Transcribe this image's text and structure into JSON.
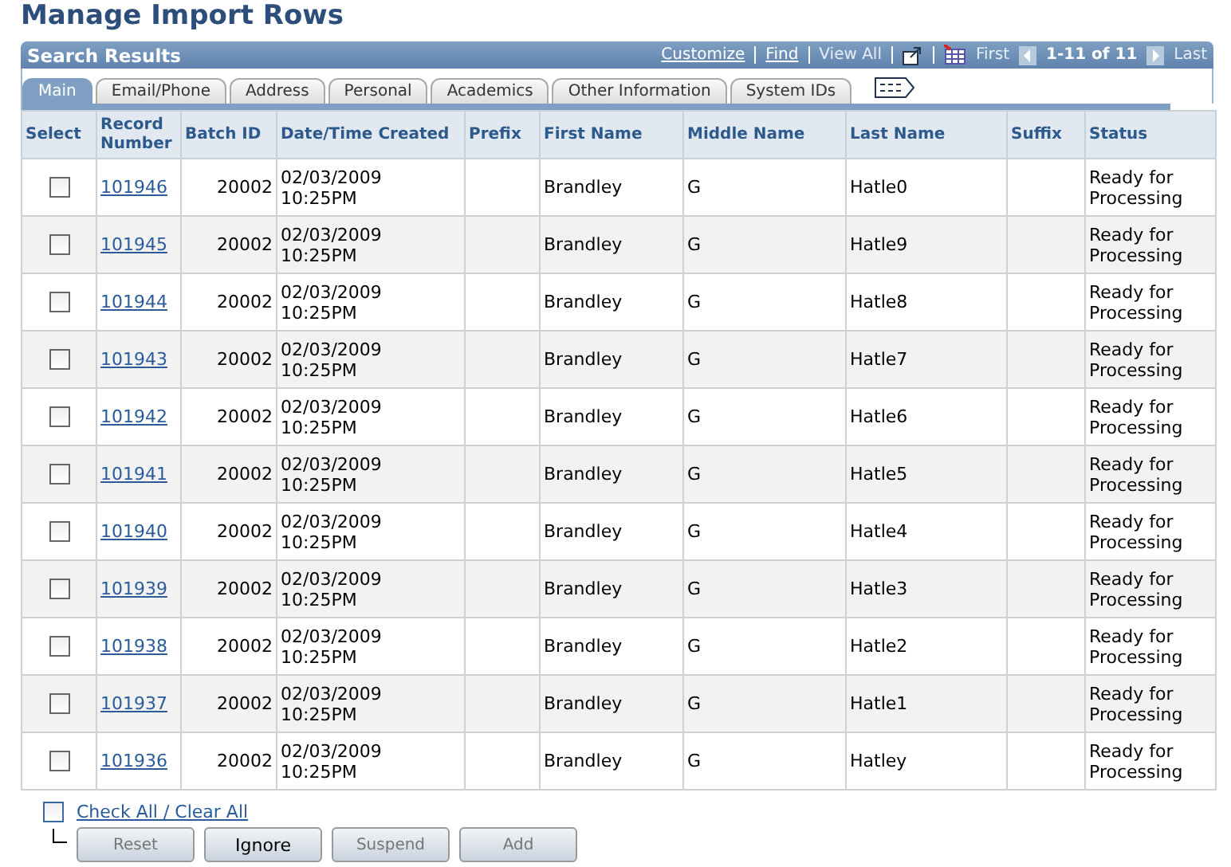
{
  "page_title": "Manage Import Rows",
  "grid": {
    "title": "Search Results",
    "links": [
      {
        "label": "Customize",
        "disabled": false
      },
      {
        "label": "Find",
        "disabled": false
      },
      {
        "label": "View All",
        "disabled": true
      }
    ],
    "first": {
      "label": "First",
      "disabled": true
    },
    "range": "1-11 of 11",
    "last": {
      "label": "Last",
      "disabled": true
    },
    "tabs": [
      {
        "label": "Main",
        "selected": true
      },
      {
        "label": "Email/Phone",
        "selected": false
      },
      {
        "label": "Address",
        "selected": false
      },
      {
        "label": "Personal",
        "selected": false
      },
      {
        "label": "Academics",
        "selected": false
      },
      {
        "label": "Other Information",
        "selected": false
      },
      {
        "label": "System IDs",
        "selected": false
      }
    ],
    "columns": [
      "Select",
      "Record Number",
      "Batch ID",
      "Date/Time Created",
      "Prefix",
      "First Name",
      "Middle Name",
      "Last Name",
      "Suffix",
      "Status"
    ],
    "rows": [
      {
        "checked": false,
        "record_number": "101946",
        "batch_id": "20002",
        "created": "02/03/2009 10:25PM",
        "first_name": "Brandley",
        "middle_name": "G",
        "last_name": "Hatle0",
        "status": "Ready for Processing"
      },
      {
        "checked": false,
        "record_number": "101945",
        "batch_id": "20002",
        "created": "02/03/2009 10:25PM",
        "first_name": "Brandley",
        "middle_name": "G",
        "last_name": "Hatle9",
        "status": "Ready for Processing"
      },
      {
        "checked": false,
        "record_number": "101944",
        "batch_id": "20002",
        "created": "02/03/2009 10:25PM",
        "first_name": "Brandley",
        "middle_name": "G",
        "last_name": "Hatle8",
        "status": "Ready for Processing"
      },
      {
        "checked": false,
        "record_number": "101943",
        "batch_id": "20002",
        "created": "02/03/2009 10:25PM",
        "first_name": "Brandley",
        "middle_name": "G",
        "last_name": "Hatle7",
        "status": "Ready for Processing"
      },
      {
        "checked": false,
        "record_number": "101942",
        "batch_id": "20002",
        "created": "02/03/2009 10:25PM",
        "first_name": "Brandley",
        "middle_name": "G",
        "last_name": "Hatle6",
        "status": "Ready for Processing"
      },
      {
        "checked": false,
        "record_number": "101941",
        "batch_id": "20002",
        "created": "02/03/2009 10:25PM",
        "first_name": "Brandley",
        "middle_name": "G",
        "last_name": "Hatle5",
        "status": "Ready for Processing"
      },
      {
        "checked": false,
        "record_number": "101940",
        "batch_id": "20002",
        "created": "02/03/2009 10:25PM",
        "first_name": "Brandley",
        "middle_name": "G",
        "last_name": "Hatle4",
        "status": "Ready for Processing"
      },
      {
        "checked": false,
        "record_number": "101939",
        "batch_id": "20002",
        "created": "02/03/2009 10:25PM",
        "first_name": "Brandley",
        "middle_name": "G",
        "last_name": "Hatle3",
        "status": "Ready for Processing"
      },
      {
        "checked": false,
        "record_number": "101938",
        "batch_id": "20002",
        "created": "02/03/2009 10:25PM",
        "first_name": "Brandley",
        "middle_name": "G",
        "last_name": "Hatle2",
        "status": "Ready for Processing"
      },
      {
        "checked": false,
        "record_number": "101937",
        "batch_id": "20002",
        "created": "02/03/2009 10:25PM",
        "first_name": "Brandley",
        "middle_name": "G",
        "last_name": "Hatle1",
        "status": "Ready for Processing"
      },
      {
        "checked": false,
        "record_number": "101936",
        "batch_id": "20002",
        "created": "02/03/2009 10:25PM",
        "first_name": "Brandley",
        "middle_name": "G",
        "last_name": "Hatley",
        "status": "Ready for Processing"
      }
    ]
  },
  "check_all": {
    "label": "Check All / Clear All",
    "checked": false
  },
  "buttons": [
    {
      "label": "Reset",
      "disabled": true
    },
    {
      "label": "Ignore",
      "disabled": false
    },
    {
      "label": "Suspend",
      "disabled": true
    },
    {
      "label": "Add",
      "disabled": true
    }
  ]
}
